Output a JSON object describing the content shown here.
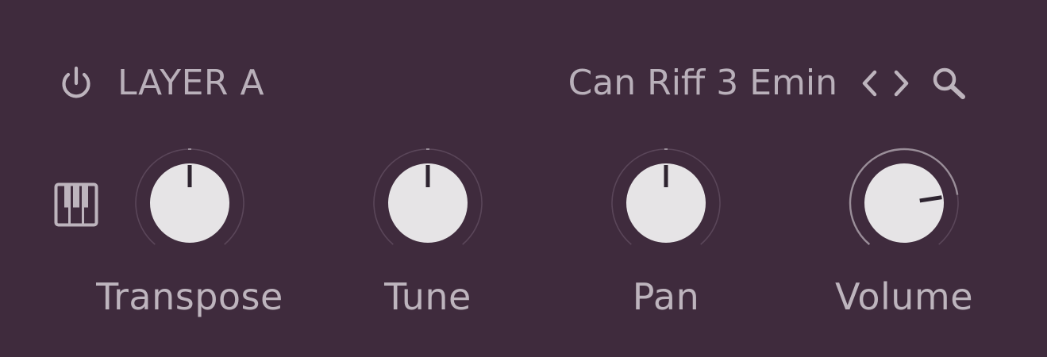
{
  "header": {
    "power_icon": "power-icon",
    "layer_name": "LAYER A",
    "preset_name": "Can Riff 3 Emin",
    "prev_icon": "chevron-left-icon",
    "next_icon": "chevron-right-icon",
    "search_icon": "search-icon"
  },
  "piano_icon": "piano-keys-icon",
  "knobs": [
    {
      "label": "Transpose",
      "value_fraction": 0.5
    },
    {
      "label": "Tune",
      "value_fraction": 0.5
    },
    {
      "label": "Pan",
      "value_fraction": 0.5
    },
    {
      "label": "Volume",
      "value_fraction": 0.79
    }
  ],
  "colors": {
    "background": "#3f2b3d",
    "text": "#bdb4bd",
    "knob_face": "#e6e4e6",
    "knob_pointer": "#2e2430",
    "ring_track": "#5a4659",
    "ring_value": "#9a8e99"
  }
}
